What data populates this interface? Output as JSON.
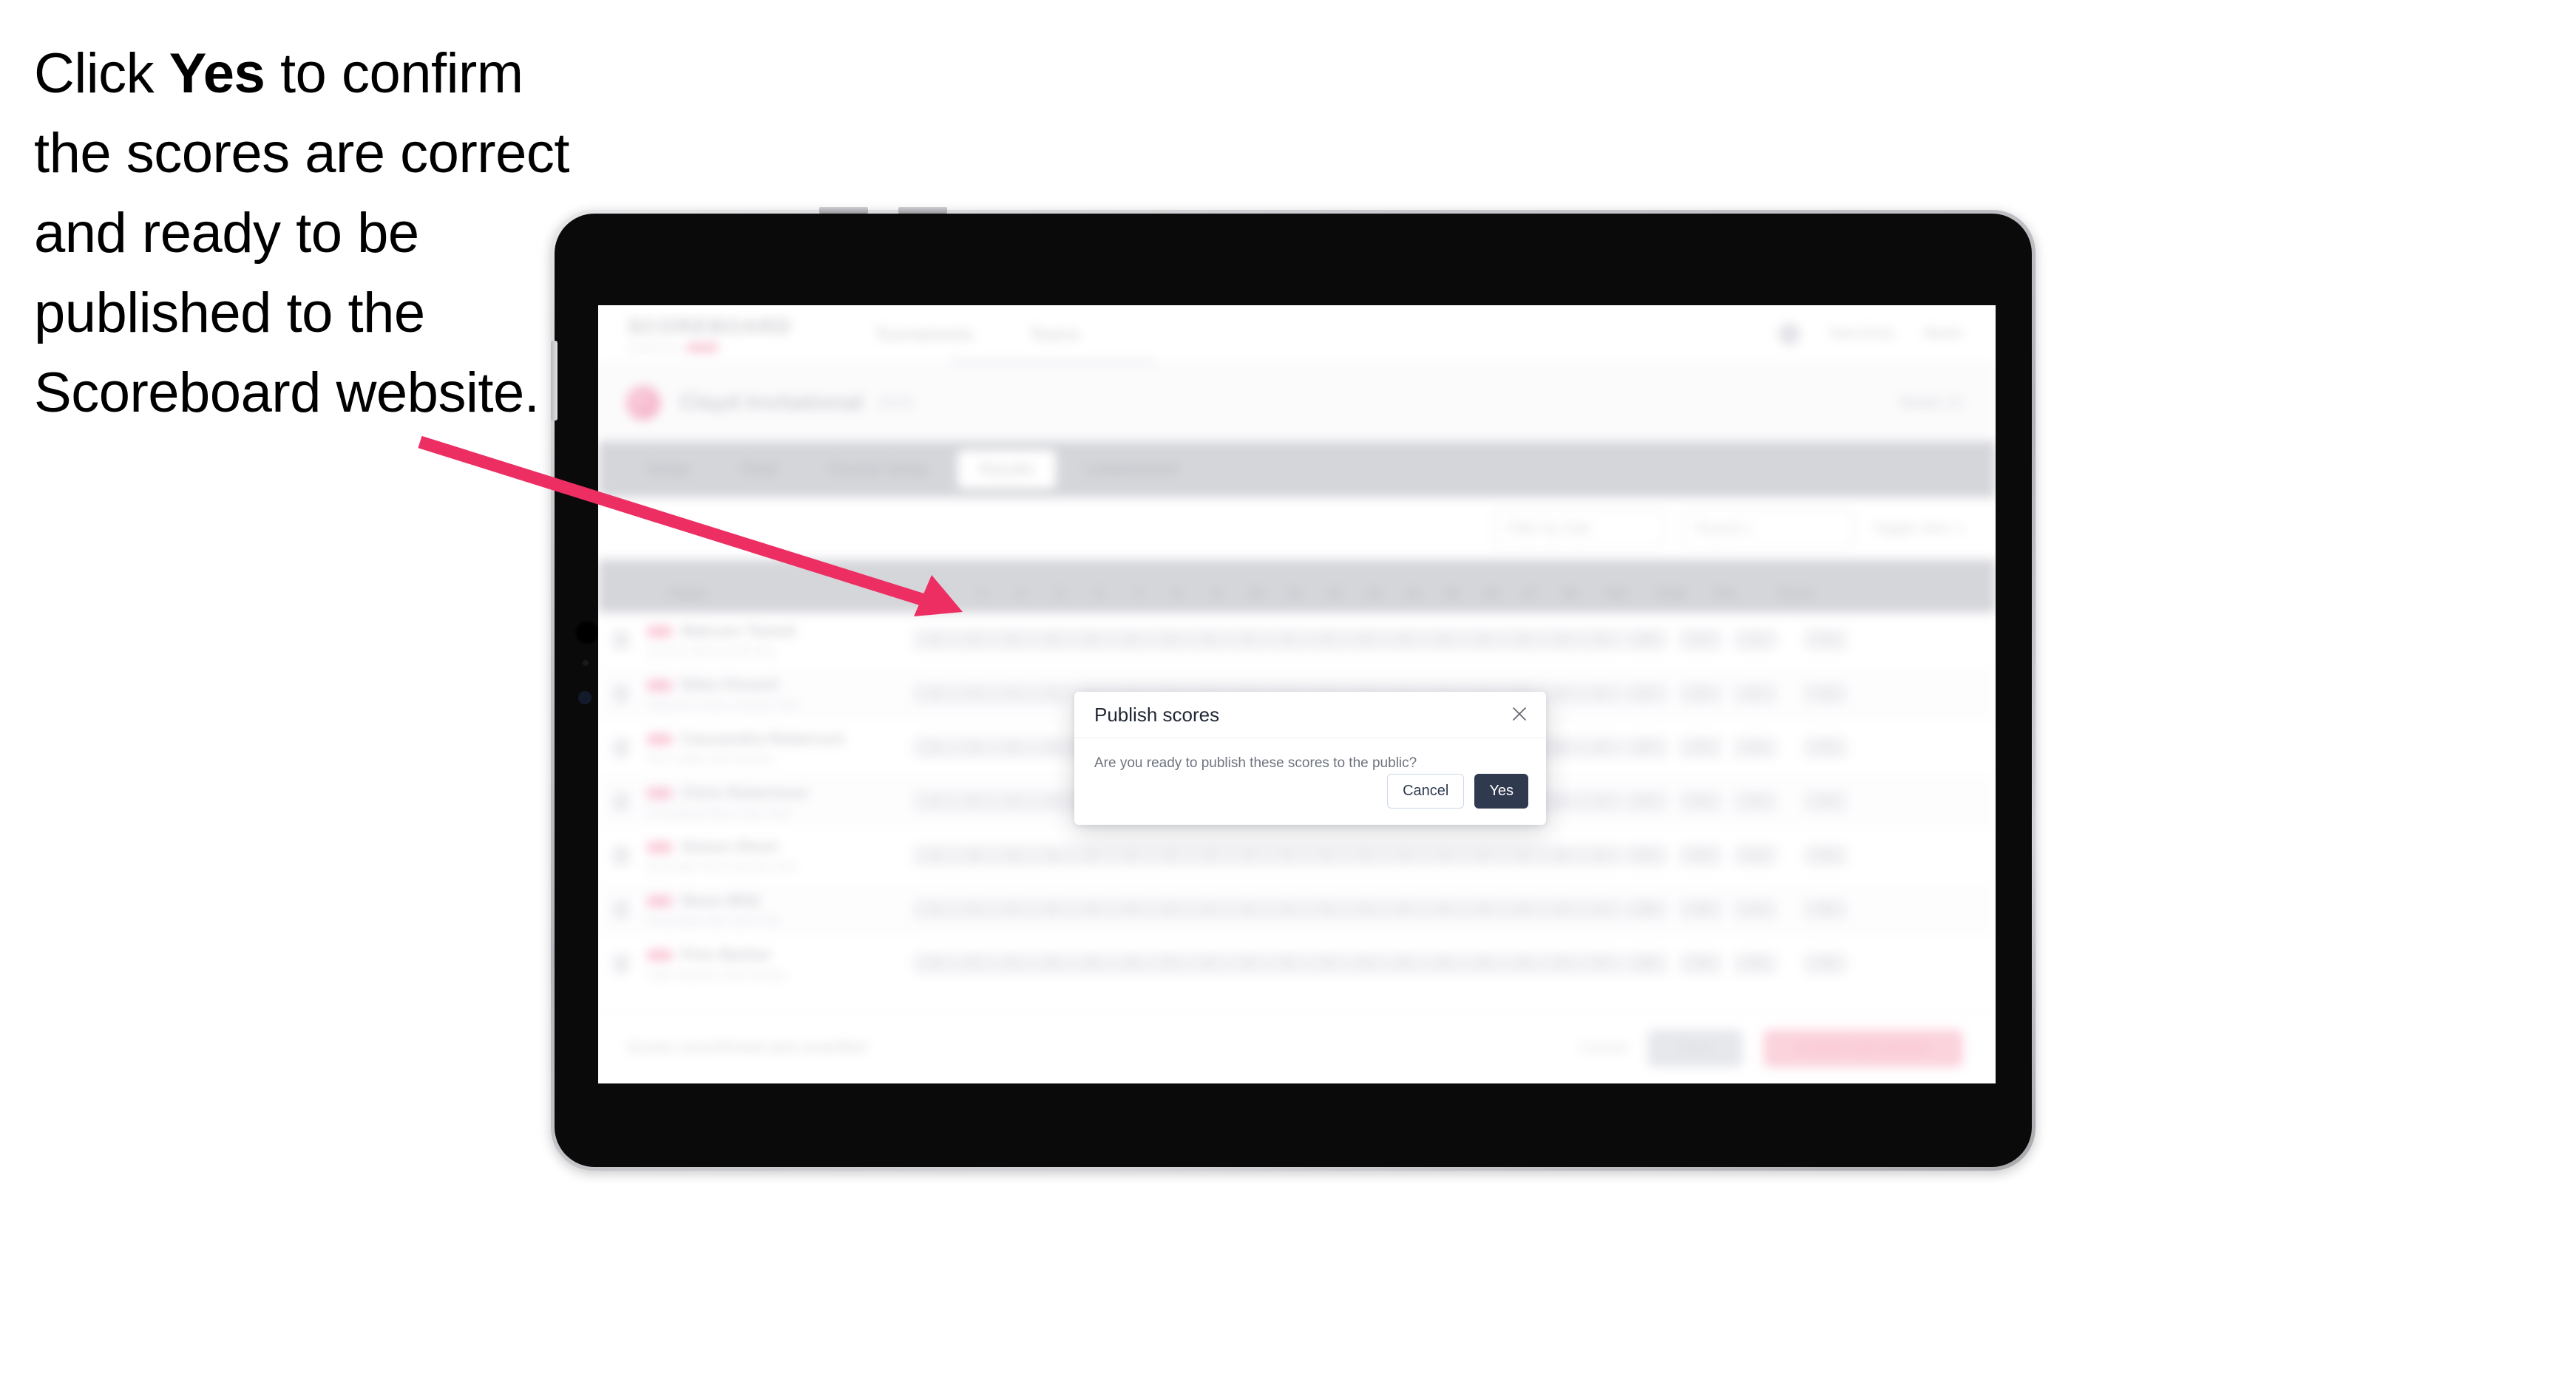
{
  "caption": {
    "before": "Click ",
    "emphasis": "Yes",
    "after": " to confirm the scores are correct and ready to be published to the Scoreboard website."
  },
  "arrow": {
    "color": "#ED2E63"
  },
  "modal": {
    "title": "Publish scores",
    "message": "Are you ready to publish these scores to the public?",
    "close_icon": "close-icon",
    "cancel_label": "Cancel",
    "confirm_label": "Yes",
    "confirm_color": "#2F3A4F",
    "cancel_border_color": "#CDD9EA"
  },
  "app": {
    "brand": {
      "word": "SCOREBOARD",
      "sub": "powered by"
    },
    "topnav": [
      "Tournaments",
      "Teams"
    ],
    "topright": [
      "New Entry",
      "Martin"
    ],
    "subhead": {
      "title": "Clayd Invitational",
      "sub": "2024",
      "right": "Week 12"
    },
    "tabs": [
      {
        "label": "Setup",
        "active": false
      },
      {
        "label": "Field",
        "active": false
      },
      {
        "label": "Course Setup",
        "active": false
      },
      {
        "label": "Results",
        "active": true
      },
      {
        "label": "Leaderboard",
        "active": false
      }
    ],
    "filters": [
      {
        "value": "Filter by hole"
      },
      {
        "value": "Round 1"
      }
    ],
    "filter_link": "Toggle view",
    "table": {
      "columns": {
        "player": "Player",
        "holes": [
          "1",
          "2",
          "3",
          "4",
          "5",
          "6",
          "7",
          "8",
          "9",
          "10",
          "11",
          "12",
          "13",
          "14",
          "15",
          "16",
          "17",
          "18"
        ],
        "out": "Out",
        "total": "Total",
        "par": "Par",
        "score": "Score"
      },
      "rows": [
        {
          "name": "Malcom Tweed",
          "club": "Hunter's Bend Golf Club",
          "holes": [
            "4",
            "3",
            "5",
            "4",
            "4",
            "3",
            "4",
            "5",
            "4",
            "4",
            "3",
            "4",
            "4",
            "5",
            "3",
            "4",
            "4",
            "4"
          ],
          "out": "36",
          "total": "71",
          "par": "-1",
          "score": "71"
        },
        {
          "name": "Ellen Peveril",
          "club": "Oakmont Links Country Club",
          "holes": [
            "4",
            "4",
            "4",
            "5",
            "3",
            "4",
            "4",
            "4",
            "5",
            "4",
            "4",
            "3",
            "4",
            "4",
            "4",
            "5",
            "3",
            "4"
          ],
          "out": "37",
          "total": "72",
          "par": "E",
          "score": "72"
        },
        {
          "name": "Cassandra Roberson",
          "club": "Pine Valley Golf Society",
          "holes": [
            "5",
            "4",
            "4",
            "4",
            "4",
            "4",
            "3",
            "5",
            "4",
            "4",
            "5",
            "4",
            "3",
            "4",
            "4",
            "4",
            "4",
            "4"
          ],
          "out": "37",
          "total": "73",
          "par": "+1",
          "score": "73"
        },
        {
          "name": "Chris Robertson",
          "club": "St Andrews Bay Links Club",
          "holes": [
            "4",
            "5",
            "4",
            "3",
            "4",
            "5",
            "4",
            "4",
            "4",
            "5",
            "4",
            "4",
            "4",
            "3",
            "5",
            "4",
            "4",
            "4"
          ],
          "out": "37",
          "total": "74",
          "par": "+2",
          "score": "74"
        },
        {
          "name": "Simon Short",
          "club": "Riverside Park Country Club",
          "holes": [
            "4",
            "4",
            "5",
            "4",
            "5",
            "4",
            "4",
            "3",
            "4",
            "4",
            "4",
            "5",
            "4",
            "4",
            "4",
            "4",
            "5",
            "4"
          ],
          "out": "37",
          "total": "75",
          "par": "+3",
          "score": "75"
        },
        {
          "name": "Nova Wild",
          "club": "Greenfield Hills Golf Club",
          "holes": [
            "5",
            "4",
            "4",
            "4",
            "4",
            "5",
            "4",
            "4",
            "4",
            "4",
            "5",
            "4",
            "4",
            "4",
            "4",
            "5",
            "4",
            "4"
          ],
          "out": "38",
          "total": "76",
          "par": "+4",
          "score": "76"
        },
        {
          "name": "Finn Barker",
          "club": "Lake Harbour Golf Society",
          "holes": [
            "4",
            "5",
            "4",
            "5",
            "4",
            "4",
            "5",
            "4",
            "4",
            "5",
            "4",
            "4",
            "5",
            "4",
            "4",
            "4",
            "4",
            "5"
          ],
          "out": "39",
          "total": "78",
          "par": "+6",
          "score": "78"
        }
      ]
    },
    "footer": {
      "note": "Scores unconfirmed and unverified",
      "link": "Cancel",
      "secondary_button": "Save",
      "primary_button": "Confirm and publish"
    }
  }
}
